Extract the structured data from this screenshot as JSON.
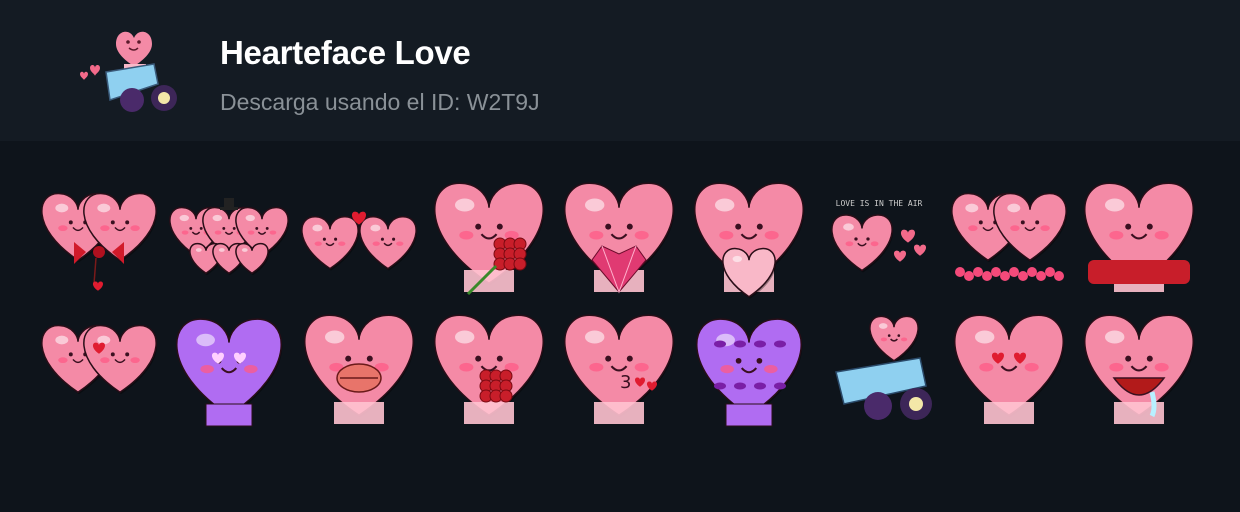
{
  "header": {
    "title": "Hearteface Love",
    "subtitle": "Descarga usando el ID: W2T9J"
  },
  "stickers": [
    {
      "name": "twin-hearts-bow",
      "variant": "twin",
      "accent": "bow"
    },
    {
      "name": "heart-family-party",
      "variant": "family",
      "accent": "hat"
    },
    {
      "name": "small-hearts-holding",
      "variant": "pair",
      "accent": "mini"
    },
    {
      "name": "heart-with-roses",
      "variant": "single",
      "accent": "roses"
    },
    {
      "name": "heart-holding-gem",
      "variant": "single",
      "accent": "gem"
    },
    {
      "name": "heart-hug",
      "variant": "single",
      "accent": "hug"
    },
    {
      "name": "heart-love-text",
      "variant": "small",
      "accent": "text",
      "caption": "LOVE IS IN THE AIR"
    },
    {
      "name": "twin-hearts-flowers",
      "variant": "twin",
      "accent": "flowers"
    },
    {
      "name": "heart-on-roses",
      "variant": "single",
      "accent": "rosebed"
    },
    {
      "name": "two-hearts-shy",
      "variant": "twin",
      "accent": "shy"
    },
    {
      "name": "purple-heart-eyes",
      "variant": "purple",
      "accent": "hearteyes"
    },
    {
      "name": "heart-kiss-lips",
      "variant": "single",
      "accent": "lips"
    },
    {
      "name": "heart-rose-bouquet",
      "variant": "single",
      "accent": "heartbouquet"
    },
    {
      "name": "heart-blowing-kiss",
      "variant": "single",
      "accent": "blowkiss"
    },
    {
      "name": "purple-heart-kisses",
      "variant": "purple",
      "accent": "kissmarks"
    },
    {
      "name": "heart-cannon",
      "variant": "cannon",
      "accent": "cannon"
    },
    {
      "name": "heart-love-eyes",
      "variant": "single",
      "accent": "loveeyes"
    },
    {
      "name": "heart-drooling",
      "variant": "single",
      "accent": "drool"
    }
  ],
  "colors": {
    "header_bg": "#141b23",
    "body_bg": "#0e141b",
    "title": "#ffffff",
    "subtitle": "#8a9197",
    "heart_pink": "#f48aa6",
    "heart_light": "#ffc2d0",
    "heart_purple": "#b06cf2",
    "cannon_blue": "#8fd0f0",
    "rose_red": "#c81e2a"
  }
}
